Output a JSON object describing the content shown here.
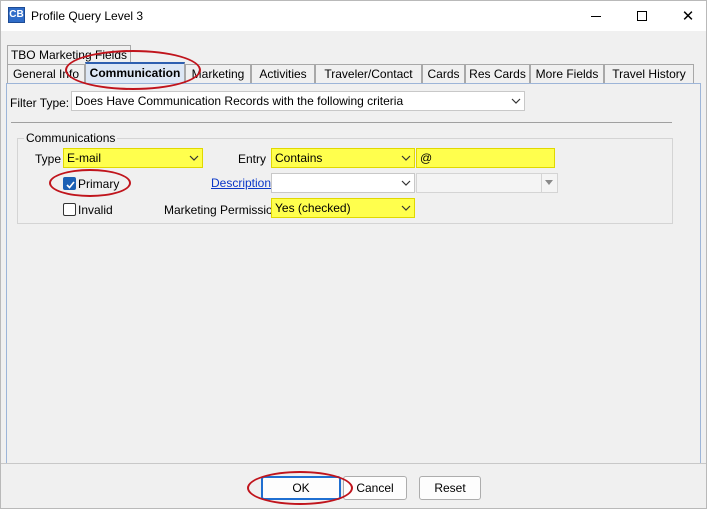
{
  "window": {
    "icon_text": "CB",
    "title": "Profile Query Level 3"
  },
  "tabs_top": [
    {
      "label": "TBO Marketing Fields"
    }
  ],
  "tabs": [
    {
      "label": "General Info"
    },
    {
      "label": "Communication",
      "selected": true
    },
    {
      "label": "Marketing"
    },
    {
      "label": "Activities"
    },
    {
      "label": "Traveler/Contact"
    },
    {
      "label": "Cards"
    },
    {
      "label": "Res Cards"
    },
    {
      "label": "More Fields"
    },
    {
      "label": "Travel History"
    }
  ],
  "filter": {
    "label": "Filter Type:",
    "value": "Does Have Communication Records with the following criteria"
  },
  "communications": {
    "group_title": "Communications",
    "type_label": "Type",
    "type_value": "E-mail",
    "entry_label": "Entry",
    "entry_mode": "Contains",
    "entry_value": "@",
    "primary_label": "Primary",
    "primary_checked": true,
    "description_label": "Description",
    "description_value": "",
    "description_sub_value": "",
    "invalid_label": "Invalid",
    "invalid_checked": false,
    "marketing_permission_label": "Marketing Permission",
    "marketing_permission_value": "Yes (checked)"
  },
  "buttons": {
    "ok": "OK",
    "cancel": "Cancel",
    "reset": "Reset"
  },
  "colors": {
    "highlight_yellow": "#ffff4d",
    "annotation_red": "#c0141c",
    "link_blue": "#0a37c8",
    "checkbox_blue": "#1a5fb4"
  }
}
